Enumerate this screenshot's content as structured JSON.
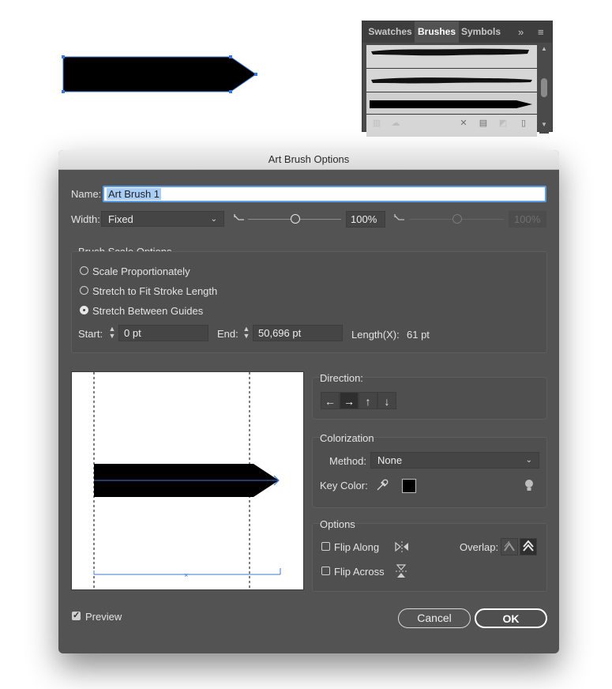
{
  "brushes_panel": {
    "tabs": [
      "Swatches",
      "Brushes",
      "Symbols"
    ],
    "active_tab": "Brushes",
    "overflow_glyph": "»",
    "menu_glyph": "≡"
  },
  "dialog": {
    "title": "Art Brush Options",
    "name_label": "Name:",
    "name_value": "Art Brush 1",
    "width_label": "Width:",
    "width_select": "Fixed",
    "width_percent": "100%",
    "width_percent_secondary": "100%",
    "width_slider_level": 0.5,
    "brush_scale": {
      "heading": "Brush Scale Options",
      "options": [
        "Scale Proportionately",
        "Stretch to Fit Stroke Length",
        "Stretch Between Guides"
      ],
      "selected": "Stretch Between Guides",
      "start_label": "Start:",
      "start_value": "0 pt",
      "end_label": "End:",
      "end_value": "50,696 pt",
      "length_label": "Length(X):",
      "length_value": "61 pt"
    },
    "direction": {
      "heading": "Direction:",
      "buttons": [
        "←",
        "→",
        "↑",
        "↓"
      ],
      "selected": "→"
    },
    "colorization": {
      "heading": "Colorization",
      "method_label": "Method:",
      "method_value": "None",
      "key_color_label": "Key Color:",
      "key_color": "#000000"
    },
    "options": {
      "heading": "Options",
      "flip_along_label": "Flip Along",
      "flip_across_label": "Flip Across",
      "overlap_label": "Overlap:",
      "flip_along": false,
      "flip_across": false
    },
    "preview_label": "Preview",
    "preview_checked": true,
    "cancel_label": "Cancel",
    "ok_label": "OK"
  },
  "colors": {
    "dialog_bg": "#535353",
    "selection_blue": "#3a78d8",
    "text": "#e6e6e6"
  }
}
